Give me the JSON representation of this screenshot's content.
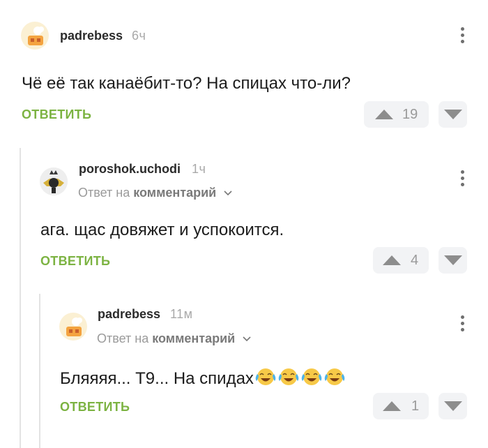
{
  "comments": [
    {
      "username": "padrebess",
      "time": "6ч",
      "text": "Чё её так канаёбит-то? На спицах что-ли?",
      "reply_label": "ОТВЕТИТЬ",
      "votes": "19"
    },
    {
      "username": "poroshok.uchodi",
      "time": "1ч",
      "reply_to_prefix": "Ответ на",
      "reply_to_target": "комментарий",
      "text": "ага. щас довяжет и успокоится.",
      "reply_label": "ОТВЕТИТЬ",
      "votes": "4"
    },
    {
      "username": "padrebess",
      "time": "11м",
      "reply_to_prefix": "Ответ на",
      "reply_to_target": "комментарий",
      "text": "Бляяяя... Т9... На спидах",
      "emojis": [
        "face-with-tears-of-joy",
        "face-with-tears-of-joy",
        "face-with-tears-of-joy",
        "face-with-tears-of-joy"
      ],
      "reply_label": "ОТВЕТИТЬ",
      "votes": "1"
    }
  ],
  "icons": {
    "more": "more-vertical-icon",
    "upvote": "upvote-arrow-icon",
    "downvote": "downvote-arrow-icon",
    "chevron": "chevron-down-icon"
  },
  "colors": {
    "reply": "#7cb342",
    "vote_bg": "#f2f3f5",
    "thread_line": "#e3e3e3"
  }
}
